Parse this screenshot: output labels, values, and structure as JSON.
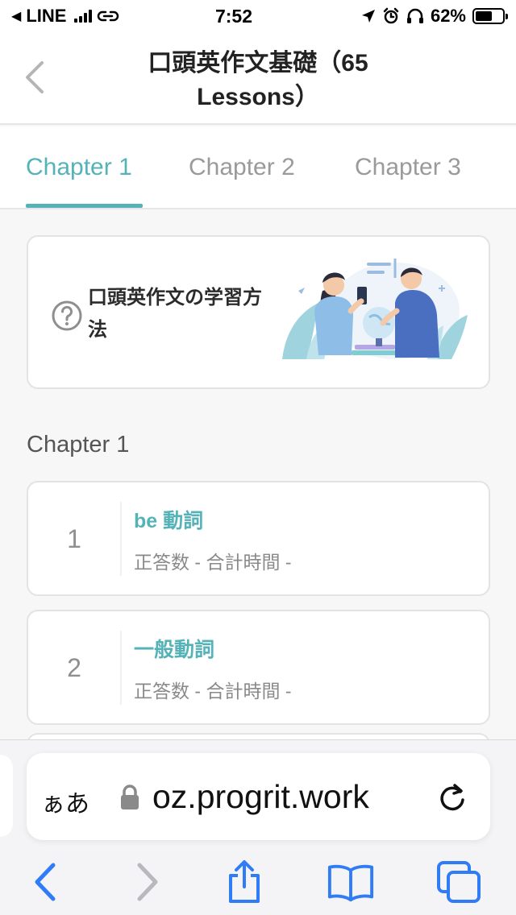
{
  "status_bar": {
    "carrier": "LINE",
    "time": "7:52",
    "battery_percent": "62%",
    "battery_level": 0.62
  },
  "header": {
    "title": "口頭英作文基礎（65 Lessons）"
  },
  "tabs": [
    {
      "label": "Chapter 1",
      "active": true
    },
    {
      "label": "Chapter 2",
      "active": false
    },
    {
      "label": "Chapter 3",
      "active": false
    }
  ],
  "method_card": {
    "label": "口頭英作文の学習方法",
    "icon": "question-circle-icon"
  },
  "section": {
    "title": "Chapter 1"
  },
  "lessons": [
    {
      "number": "1",
      "title": "be 動詞",
      "meta": "正答数 - 合計時間 -"
    },
    {
      "number": "2",
      "title": "一般動詞",
      "meta": "正答数 - 合計時間 -"
    }
  ],
  "browser": {
    "aa_label": "ぁあ",
    "url": "oz.progrit.work"
  },
  "colors": {
    "accent": "#55b3b8",
    "ios_blue": "#2f7cf6"
  }
}
